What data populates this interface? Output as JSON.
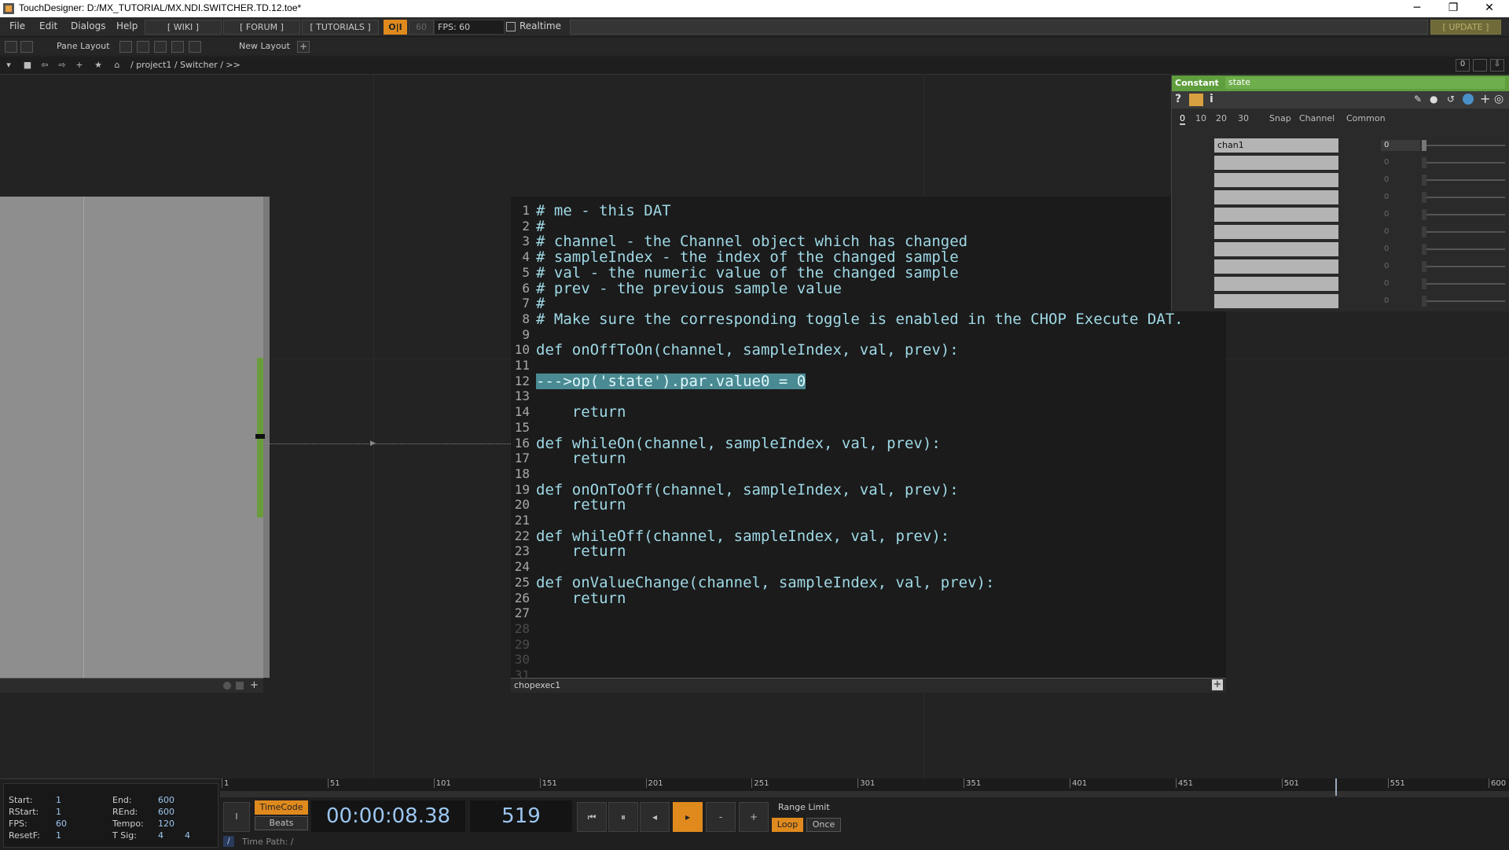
{
  "window": {
    "title": "TouchDesigner: D:/MX_TUTORIAL/MX.NDI.SWITCHER.TD.12.toe*",
    "minimize": "─",
    "restore": "❐",
    "close": "✕"
  },
  "menubar": {
    "items": [
      "File",
      "Edit",
      "Dialogs",
      "Help"
    ],
    "wiki": "[ WIKI ]",
    "forum": "[ FORUM ]",
    "tutorials": "[ TUTORIALS ]",
    "oi": "O|I",
    "fps_cap": "60",
    "fps": "FPS: 60",
    "realtime": "Realtime",
    "update": "[ UPDATE ]"
  },
  "panerow": {
    "pane_layout": "Pane Layout",
    "new_layout": "New Layout",
    "plus": "+"
  },
  "pathbar": {
    "path": "/ project1 / Switcher / >>",
    "right_count": "0"
  },
  "viewer": {
    "name": "chopexec1",
    "lines": [
      {
        "n": "1",
        "t": "# me - this DAT"
      },
      {
        "n": "2",
        "t": "#"
      },
      {
        "n": "3",
        "t": "# channel - the Channel object which has changed"
      },
      {
        "n": "4",
        "t": "# sampleIndex - the index of the changed sample"
      },
      {
        "n": "5",
        "t": "# val - the numeric value of the changed sample"
      },
      {
        "n": "6",
        "t": "# prev - the previous sample value"
      },
      {
        "n": "7",
        "t": "#"
      },
      {
        "n": "8",
        "t": "# Make sure the corresponding toggle is enabled in the CHOP Execute DAT."
      },
      {
        "n": "9",
        "t": ""
      },
      {
        "n": "10",
        "t": "def onOffToOn(channel, sampleIndex, val, prev):"
      },
      {
        "n": "11",
        "t": ""
      },
      {
        "n": "12",
        "t": "--->op('state').par.value0 = 0"
      },
      {
        "n": "13",
        "t": ""
      },
      {
        "n": "14",
        "t": "    return"
      },
      {
        "n": "15",
        "t": ""
      },
      {
        "n": "16",
        "t": "def whileOn(channel, sampleIndex, val, prev):"
      },
      {
        "n": "17",
        "t": "    return"
      },
      {
        "n": "18",
        "t": ""
      },
      {
        "n": "19",
        "t": "def onOnToOff(channel, sampleIndex, val, prev):"
      },
      {
        "n": "20",
        "t": "    return"
      },
      {
        "n": "21",
        "t": ""
      },
      {
        "n": "22",
        "t": "def whileOff(channel, sampleIndex, val, prev):"
      },
      {
        "n": "23",
        "t": "    return"
      },
      {
        "n": "24",
        "t": ""
      },
      {
        "n": "25",
        "t": "def onValueChange(channel, sampleIndex, val, prev):"
      },
      {
        "n": "26",
        "t": "    return"
      },
      {
        "n": "27",
        "t": ""
      },
      {
        "n": "28",
        "t": ""
      },
      {
        "n": "29",
        "t": ""
      },
      {
        "n": "30",
        "t": ""
      },
      {
        "n": "31",
        "t": ""
      }
    ],
    "highlight_line": 12,
    "add_icon": "+"
  },
  "param": {
    "type": "Constant",
    "name": "state",
    "tabs": [
      "0",
      "10",
      "20",
      "30",
      "Snap",
      "Channel",
      "Common"
    ],
    "rows": [
      {
        "name": "chan1",
        "value": "0"
      },
      {
        "name": "",
        "value": "0"
      },
      {
        "name": "",
        "value": "0"
      },
      {
        "name": "",
        "value": "0"
      },
      {
        "name": "",
        "value": "0"
      },
      {
        "name": "",
        "value": "0"
      },
      {
        "name": "",
        "value": "0"
      },
      {
        "name": "",
        "value": "0"
      },
      {
        "name": "",
        "value": "0"
      },
      {
        "name": "",
        "value": "0"
      }
    ],
    "header_color": "#5f9e3d"
  },
  "timeline": {
    "labels": {
      "start": "Start:",
      "start_v": "1",
      "end": "End:",
      "end_v": "600",
      "rstart": "RStart:",
      "rstart_v": "1",
      "rend": "REnd:",
      "rend_v": "600",
      "fps": "FPS:",
      "fps_v": "60",
      "tempo": "Tempo:",
      "tempo_v": "120",
      "resetf": "ResetF:",
      "resetf_v": "1",
      "tsig": "T Sig:",
      "tsig_a": "4",
      "tsig_b": "4"
    },
    "ruler": [
      "1",
      "51",
      "101",
      "151",
      "201",
      "251",
      "301",
      "351",
      "401",
      "451",
      "501",
      "551",
      "600"
    ],
    "current_frame_fraction": 0.865,
    "timecode_btn": "TimeCode",
    "beats_btn": "Beats",
    "timecode": "00:00:08.38",
    "frame": "519",
    "range_limit": "Range Limit",
    "loop": "Loop",
    "once": "Once",
    "time_path": "Time Path: /",
    "slash": "/",
    "i_btn": "I",
    "minus": "-",
    "plus": "+"
  }
}
